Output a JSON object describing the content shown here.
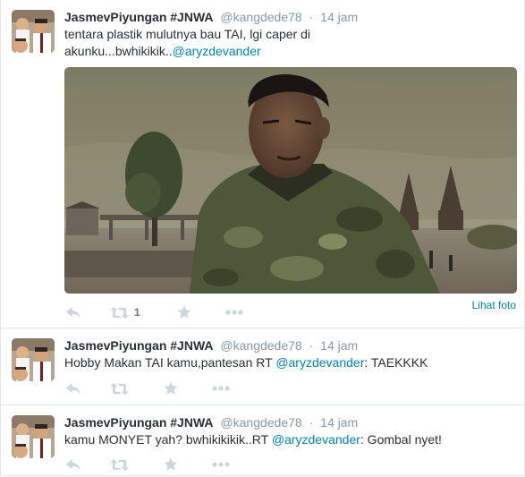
{
  "tweets": [
    {
      "fullname": "JasmevPiyungan #JNWA",
      "handle": "@kangdede78",
      "time": "14 jam",
      "text_line1": "tentara plastik mulutnya bau TAI, lgi caper di",
      "text_line2_prefix": "akunku...bwhikikik..",
      "text_line2_mention": "@aryzdevander",
      "retweet_count": "1",
      "view_photo_label": "Lihat foto"
    },
    {
      "fullname": "JasmevPiyungan #JNWA",
      "handle": "@kangdede78",
      "time": "14 jam",
      "text_prefix": "Hobby Makan TAI kamu,pantesan RT ",
      "text_mention": "@aryzdevander",
      "text_suffix": ": TAEKKKK"
    },
    {
      "fullname": "JasmevPiyungan #JNWA",
      "handle": "@kangdede78",
      "time": "14 jam",
      "text_prefix": "kamu MONYET yah? bwhikikikik..RT ",
      "text_mention": "@aryzdevander",
      "text_suffix": ": Gombal nyet!"
    }
  ],
  "icons": {
    "reply": "reply-icon",
    "retweet": "retweet-icon",
    "favorite": "star-icon",
    "more": "more-icon"
  },
  "colors": {
    "link": "#0084b4",
    "meta": "#8899a6",
    "action_icon": "#ccd6dd",
    "text": "#292f33"
  }
}
